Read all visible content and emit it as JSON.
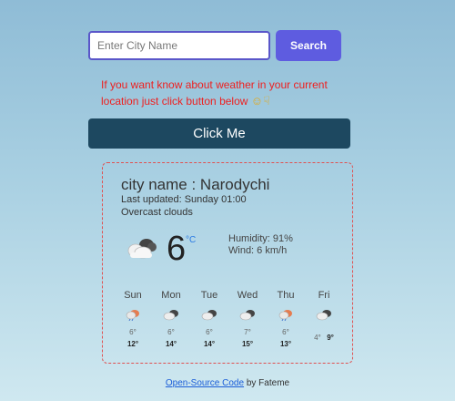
{
  "search": {
    "placeholder": "Enter City Name",
    "button_label": "Search"
  },
  "hint": {
    "text": "If you want know about weather in your current location just click button below"
  },
  "click_button": {
    "label": "Click Me"
  },
  "current": {
    "city": "city name : Narodychi",
    "updated": "Last updated: Sunday 01:00",
    "description": "Overcast clouds",
    "temp": "6",
    "unit": "°C",
    "humidity": "Humidity: 91%",
    "wind": "Wind: 6 km/h",
    "icon": "overcast-clouds-icon"
  },
  "forecast": [
    {
      "day": "Sun",
      "low": "6°",
      "high": "12°",
      "icon": "rain-cloud-icon"
    },
    {
      "day": "Mon",
      "low": "6°",
      "high": "14°",
      "icon": "cloud-icon"
    },
    {
      "day": "Tue",
      "low": "6°",
      "high": "14°",
      "icon": "cloud-icon"
    },
    {
      "day": "Wed",
      "low": "7°",
      "high": "15°",
      "icon": "cloud-icon"
    },
    {
      "day": "Thu",
      "low": "6°",
      "high": "13°",
      "icon": "rain-cloud-icon"
    },
    {
      "day": "Fri",
      "low": "4°",
      "high": "9°",
      "icon": "cloud-icon"
    }
  ],
  "footer": {
    "link_text": "Open-Source Code",
    "suffix": " by Fateme"
  },
  "colors": {
    "search_button": "#5e5ce0",
    "click_button": "#1d4860",
    "hint": "#ee2020",
    "card_border": "#e05050",
    "link": "#1a5dd8"
  }
}
